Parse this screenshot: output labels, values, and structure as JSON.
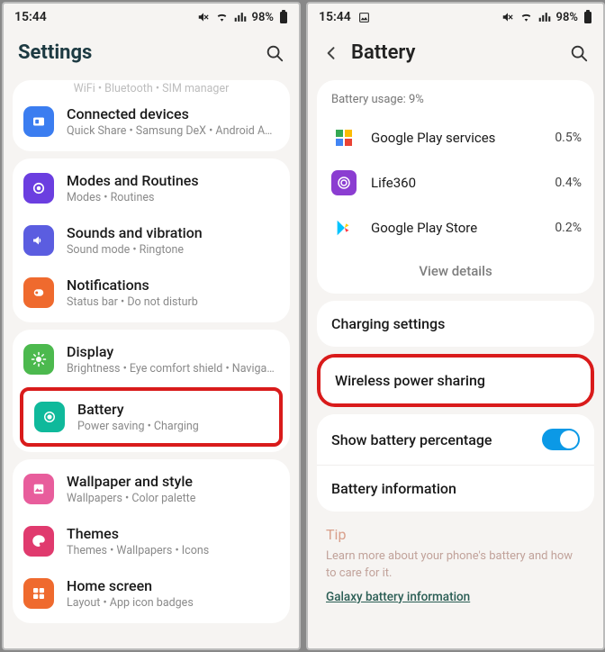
{
  "status": {
    "time": "15:44",
    "battery_pct": "98%"
  },
  "left": {
    "title": "Settings",
    "clipped_sub": "WiFi  •  Bluetooth  •  SIM manager",
    "items": [
      {
        "label": "Connected devices",
        "sub": "Quick Share  •  Samsung DeX  •  Android Auto"
      },
      {
        "label": "Modes and Routines",
        "sub": "Modes  •  Routines"
      },
      {
        "label": "Sounds and vibration",
        "sub": "Sound mode  •  Ringtone"
      },
      {
        "label": "Notifications",
        "sub": "Status bar  •  Do not disturb"
      },
      {
        "label": "Display",
        "sub": "Brightness  •  Eye comfort shield  •  Navigation bar"
      },
      {
        "label": "Battery",
        "sub": "Power saving  •  Charging"
      },
      {
        "label": "Wallpaper and style",
        "sub": "Wallpapers  •  Color palette"
      },
      {
        "label": "Themes",
        "sub": "Themes  •  Wallpapers  •  Icons"
      },
      {
        "label": "Home screen",
        "sub": "Layout  •  App icon badges"
      }
    ]
  },
  "right": {
    "title": "Battery",
    "usage_label": "Battery usage: 9%",
    "apps": [
      {
        "name": "Google Play services",
        "pct": "0.5%"
      },
      {
        "name": "Life360",
        "pct": "0.4%"
      },
      {
        "name": "Google Play Store",
        "pct": "0.2%"
      }
    ],
    "view_details": "View details",
    "charging": "Charging settings",
    "wireless": "Wireless power sharing",
    "show_pct": "Show battery percentage",
    "info": "Battery information",
    "tip": {
      "title": "Tip",
      "body": "Learn more about your phone's battery and how to care for it.",
      "link": "Galaxy battery information"
    }
  },
  "icons": {
    "connected": "#3b7df0",
    "modes": "#6b3ee0",
    "sounds": "#5b5de0",
    "notif": "#ef6a2e",
    "display": "#4cb94e",
    "battery": "#0fb99b",
    "wallpaper": "#e85d9c",
    "themes": "#e03a6e",
    "home": "#ef6a2e"
  }
}
